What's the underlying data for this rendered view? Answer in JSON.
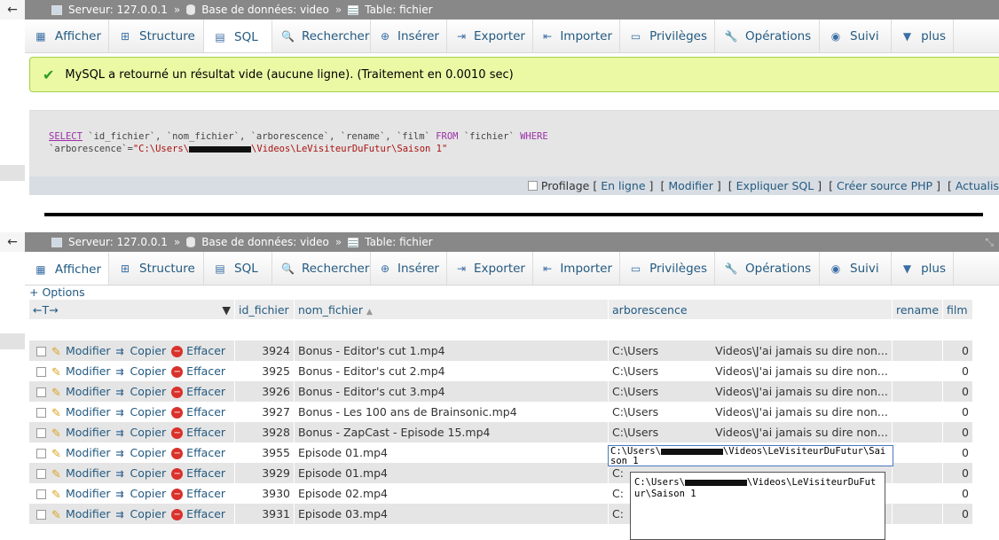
{
  "breadcrumb": {
    "server_label": "Serveur: 127.0.0.1",
    "separator": "»",
    "database_label": "Base de données: video",
    "table_label": "Table: fichier",
    "back_icon": "←"
  },
  "tabs": [
    {
      "label": "Afficher",
      "icon": "table-icon"
    },
    {
      "label": "Structure",
      "icon": "structure-icon"
    },
    {
      "label": "SQL",
      "icon": "sql-icon"
    },
    {
      "label": "Rechercher",
      "icon": "search-icon"
    },
    {
      "label": "Insérer",
      "icon": "insert-icon"
    },
    {
      "label": "Exporter",
      "icon": "export-icon"
    },
    {
      "label": "Importer",
      "icon": "import-icon"
    },
    {
      "label": "Privilèges",
      "icon": "privileges-icon"
    },
    {
      "label": "Opérations",
      "icon": "wrench-icon"
    },
    {
      "label": "Suivi",
      "icon": "eye-icon"
    },
    {
      "label": "plus",
      "icon": "chevron-down-icon"
    }
  ],
  "success_message": "MySQL a retourné un résultat vide (aucune ligne). (Traitement en 0.0010 sec)",
  "sql": {
    "select": "SELECT",
    "columns": "`id_fichier`, `nom_fichier`, `arborescence`, `rename`, `film`",
    "from": "FROM",
    "table": "`fichier`",
    "where": "WHERE",
    "condition_field": "`arborescence`=",
    "value_prefix": "\"C:\\Users\\",
    "value_suffix": "\\Videos\\LeVisiteurDuFutur\\Saison 1\""
  },
  "sql_footer": {
    "profilage": "Profilage",
    "links": [
      "En ligne",
      "Modifier",
      "Expliquer SQL",
      "Créer source PHP",
      "Actualis"
    ]
  },
  "options_link": "+ Options",
  "column_headers": {
    "arrows": "←T→",
    "id_fichier": "id_fichier",
    "nom_fichier": "nom_fichier",
    "sort_icon": "▲",
    "arborescence": "arborescence",
    "rename": "rename",
    "film": "film"
  },
  "row_actions": {
    "edit": "Modifier",
    "copy": "Copier",
    "delete": "Effacer"
  },
  "rows": [
    {
      "id": "3924",
      "nom": "Bonus - Editor's cut 1.mp4",
      "arbo_left": "C:\\Users",
      "arbo_right": "Videos\\J'ai jamais su dire non...",
      "film": "0"
    },
    {
      "id": "3925",
      "nom": "Bonus - Editor's cut 2.mp4",
      "arbo_left": "C:\\Users",
      "arbo_right": "Videos\\J'ai jamais su dire non...",
      "film": "0"
    },
    {
      "id": "3926",
      "nom": "Bonus - Editor's cut 3.mp4",
      "arbo_left": "C:\\Users",
      "arbo_right": "Videos\\J'ai jamais su dire non...",
      "film": "0"
    },
    {
      "id": "3927",
      "nom": "Bonus - Les 100 ans de Brainsonic.mp4",
      "arbo_left": "C:\\Users",
      "arbo_right": "Videos\\J'ai jamais su dire non...",
      "film": "0"
    },
    {
      "id": "3928",
      "nom": "Bonus - ZapCast - Episode 15.mp4",
      "arbo_left": "C:\\Users",
      "arbo_right": "Videos\\J'ai jamais su dire non...",
      "film": "0"
    },
    {
      "id": "3955",
      "nom": "Episode 01.mp4",
      "arbo_left": "",
      "arbo_right": "",
      "film": "0"
    },
    {
      "id": "3929",
      "nom": "Episode 01.mp4",
      "arbo_left": "C:",
      "arbo_right": "",
      "film": "0"
    },
    {
      "id": "3930",
      "nom": "Episode 02.mp4",
      "arbo_left": "C:",
      "arbo_right": "",
      "film": "0"
    },
    {
      "id": "3931",
      "nom": "Episode 03.mp4",
      "arbo_left": "C:",
      "arbo_right": "",
      "film": "0"
    }
  ],
  "edit_value": {
    "prefix": "C:\\Users\\",
    "suffix": "\\Videos\\LeVisiteurDuFutur\\Saison 1"
  },
  "popup_value": {
    "prefix": "C:\\Users\\",
    "suffix": "\\Videos\\LeVisiteurDuFutur\\Saison 1"
  },
  "colors": {
    "accent": "#235a81",
    "success_bg": "#ebf8a4",
    "topbar": "#888888"
  }
}
